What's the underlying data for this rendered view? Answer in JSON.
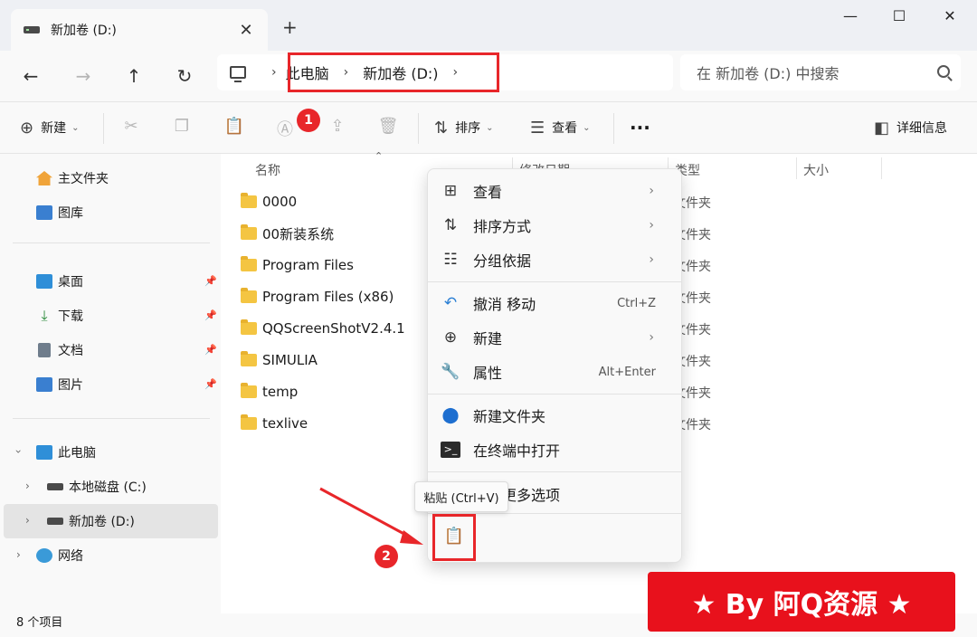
{
  "window": {
    "tab_title": "新加卷 (D:)",
    "tab_close": "✕",
    "new_tab": "+",
    "minimize": "—",
    "maximize": "☐",
    "close": "✕"
  },
  "nav": {
    "back": "←",
    "forward": "→",
    "up": "↑",
    "refresh": "↻",
    "breadcrumbs": [
      "此电脑",
      "新加卷 (D:)"
    ],
    "sep": "›",
    "search_placeholder": "在 新加卷 (D:) 中搜索"
  },
  "commandbar": {
    "new_label": "新建",
    "sort_label": "排序",
    "view_label": "查看",
    "more": "···",
    "details_label": "详细信息"
  },
  "leftnav": {
    "quick": [
      {
        "label": "主文件夹"
      },
      {
        "label": "图库"
      }
    ],
    "pinned": [
      {
        "label": "桌面"
      },
      {
        "label": "下载"
      },
      {
        "label": "文档"
      },
      {
        "label": "图片"
      }
    ],
    "this_pc": "此电脑",
    "drive_c": "本地磁盘 (C:)",
    "drive_d": "新加卷 (D:)",
    "network": "网络"
  },
  "columns": {
    "name": "名称",
    "modified": "修改日期",
    "type": "类型",
    "size": "大小"
  },
  "files": [
    {
      "name": "0000",
      "type": "文件夹"
    },
    {
      "name": "00新装系统",
      "type": "文件夹"
    },
    {
      "name": "Program Files",
      "type": "文件夹"
    },
    {
      "name": "Program Files (x86)",
      "type": "文件夹"
    },
    {
      "name": "QQScreenShotV2.4.1",
      "type": "文件夹"
    },
    {
      "name": "SIMULIA",
      "type": "文件夹"
    },
    {
      "name": "temp",
      "type": "文件夹"
    },
    {
      "name": "texlive",
      "type": "文件夹"
    }
  ],
  "context_menu": {
    "view": "查看",
    "sort_by": "排序方式",
    "group_by": "分组依据",
    "undo_move": "撤消 移动",
    "undo_shortcut": "Ctrl+Z",
    "new": "新建",
    "properties": "属性",
    "properties_shortcut": "Alt+Enter",
    "new_folder": "新建文件夹",
    "open_terminal": "在终端中打开",
    "more_options": "显示更多选项",
    "paste_tooltip": "粘贴 (Ctrl+V)"
  },
  "annotations": {
    "step1": "1",
    "step2": "2"
  },
  "status": {
    "item_count": "8 个项目"
  },
  "banner": {
    "text": "★ By 阿Q资源 ★"
  },
  "colors": {
    "accent_red": "#e8262a",
    "banner_red": "#e8111c",
    "folder_yellow": "#f4c542"
  }
}
